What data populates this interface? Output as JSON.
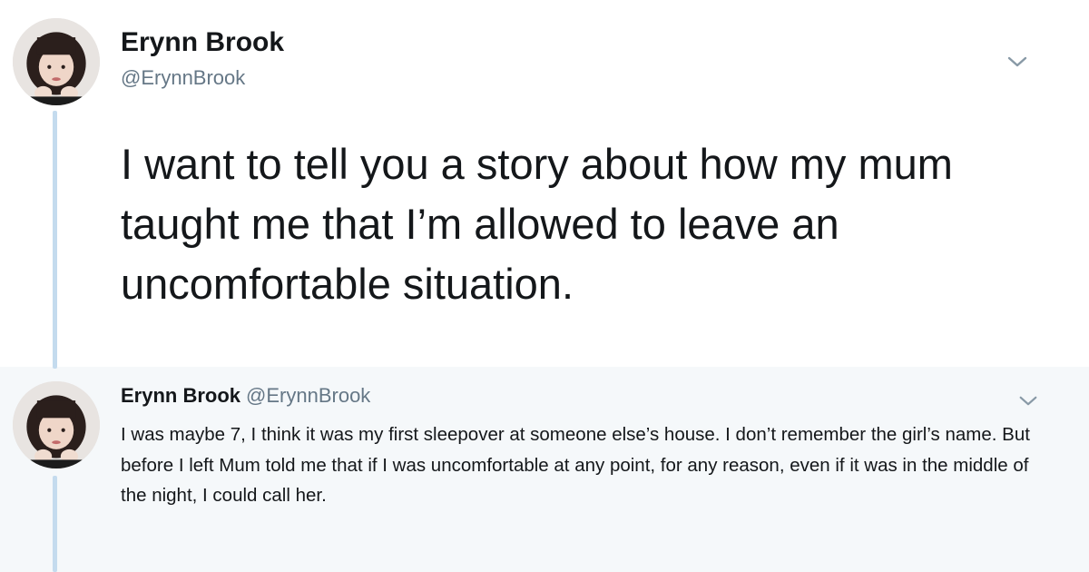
{
  "main_tweet": {
    "author_name": "Erynn Brook",
    "handle": "@ErynnBrook",
    "text": "I want to tell you a story about how my mum taught me that I’m allowed to leave an uncomfortable situation."
  },
  "reply_tweet": {
    "author_name": "Erynn Brook",
    "handle": "@ErynnBrook",
    "text": "I was maybe 7, I think it was my first sleepover at someone else’s house. I don’t remember the girl’s name. But before I left Mum told me that if I was uncomfortable at any point, for any reason, even if it was in the middle of the night, I could call her."
  },
  "icons": {
    "avatar": "avatar-photo",
    "menu": "chevron-down-icon"
  },
  "colors": {
    "thread_line": "#c4dbee",
    "reply_bg": "#f5f8fa",
    "handle": "#657786",
    "text": "#14171a"
  }
}
